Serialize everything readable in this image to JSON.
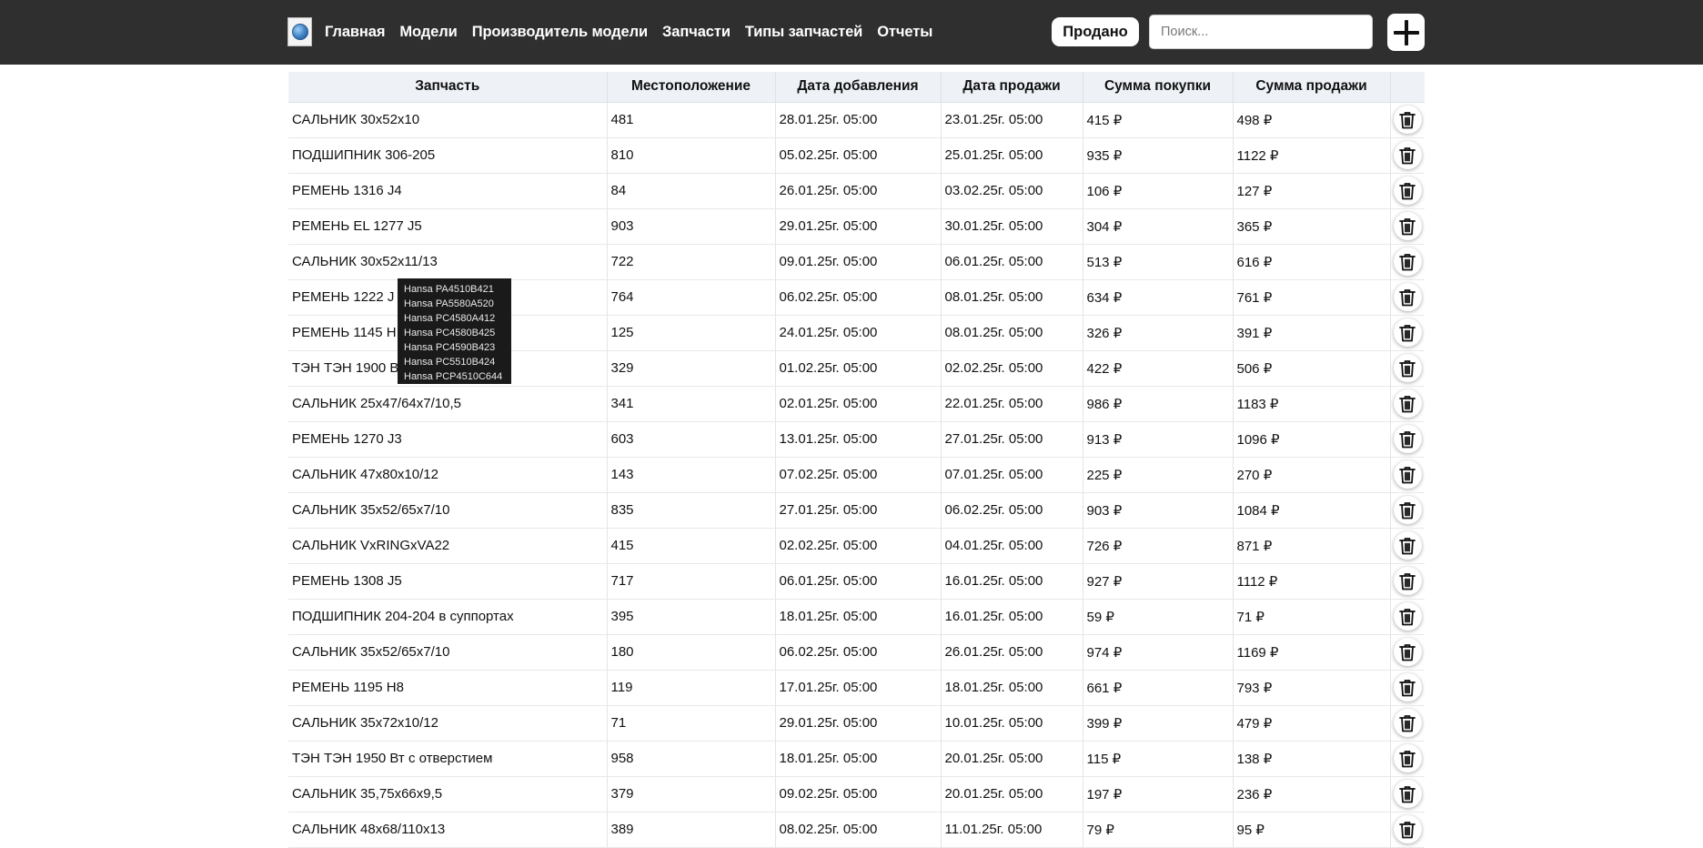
{
  "navbar": {
    "links": [
      "Главная",
      "Модели",
      "Производитель модели",
      "Запчасти",
      "Типы запчастей",
      "Отчеты"
    ],
    "sold_button": "Продано",
    "search_placeholder": "Поиск..."
  },
  "table": {
    "columns": [
      "Запчасть",
      "Местоположение",
      "Дата добавления",
      "Дата продажи",
      "Сумма покупки",
      "Сумма продажи",
      ""
    ],
    "rows": [
      [
        "САЛЬНИК 30x52x10",
        "481",
        "28.01.25г. 05:00",
        "23.01.25г. 05:00",
        "415 ₽",
        "498 ₽"
      ],
      [
        "ПОДШИПНИК 306-205",
        "810",
        "05.02.25г. 05:00",
        "25.01.25г. 05:00",
        "935 ₽",
        "1122 ₽"
      ],
      [
        "РЕМЕНЬ 1316 J4",
        "84",
        "26.01.25г. 05:00",
        "03.02.25г. 05:00",
        "106 ₽",
        "127 ₽"
      ],
      [
        "РЕМЕНЬ EL 1277 J5",
        "903",
        "29.01.25г. 05:00",
        "30.01.25г. 05:00",
        "304 ₽",
        "365 ₽"
      ],
      [
        "САЛЬНИК 30x52x11/13",
        "722",
        "09.01.25г. 05:00",
        "06.01.25г. 05:00",
        "513 ₽",
        "616 ₽"
      ],
      [
        "РЕМЕНЬ 1222 J",
        "764",
        "06.02.25г. 05:00",
        "08.01.25г. 05:00",
        "634 ₽",
        "761 ₽"
      ],
      [
        "РЕМЕНЬ 1145 H",
        "125",
        "24.01.25г. 05:00",
        "08.01.25г. 05:00",
        "326 ₽",
        "391 ₽"
      ],
      [
        "ТЭН ТЭН 1900 B",
        "329",
        "01.02.25г. 05:00",
        "02.02.25г. 05:00",
        "422 ₽",
        "506 ₽"
      ],
      [
        "САЛЬНИК 25x47/64x7/10,5",
        "341",
        "02.01.25г. 05:00",
        "22.01.25г. 05:00",
        "986 ₽",
        "1183 ₽"
      ],
      [
        "РЕМЕНЬ 1270 J3",
        "603",
        "13.01.25г. 05:00",
        "27.01.25г. 05:00",
        "913 ₽",
        "1096 ₽"
      ],
      [
        "САЛЬНИК 47x80x10/12",
        "143",
        "07.02.25г. 05:00",
        "07.01.25г. 05:00",
        "225 ₽",
        "270 ₽"
      ],
      [
        "САЛЬНИК 35x52/65x7/10",
        "835",
        "27.01.25г. 05:00",
        "06.02.25г. 05:00",
        "903 ₽",
        "1084 ₽"
      ],
      [
        "САЛЬНИК VxRINGxVA22",
        "415",
        "02.02.25г. 05:00",
        "04.01.25г. 05:00",
        "726 ₽",
        "871 ₽"
      ],
      [
        "РЕМЕНЬ 1308 J5",
        "717",
        "06.01.25г. 05:00",
        "16.01.25г. 05:00",
        "927 ₽",
        "1112 ₽"
      ],
      [
        "ПОДШИПНИК 204-204 в суппортах",
        "395",
        "18.01.25г. 05:00",
        "16.01.25г. 05:00",
        "59 ₽",
        "71 ₽"
      ],
      [
        "САЛЬНИК 35x52/65x7/10",
        "180",
        "06.02.25г. 05:00",
        "26.01.25г. 05:00",
        "974 ₽",
        "1169 ₽"
      ],
      [
        "РЕМЕНЬ 1195 H8",
        "119",
        "17.01.25г. 05:00",
        "18.01.25г. 05:00",
        "661 ₽",
        "793 ₽"
      ],
      [
        "САЛЬНИК 35x72x10/12",
        "71",
        "29.01.25г. 05:00",
        "10.01.25г. 05:00",
        "399 ₽",
        "479 ₽"
      ],
      [
        "ТЭН ТЭН 1950 Вт с отверстием",
        "958",
        "18.01.25г. 05:00",
        "20.01.25г. 05:00",
        "115 ₽",
        "138 ₽"
      ],
      [
        "САЛЬНИК 35,75x66x9,5",
        "379",
        "09.02.25г. 05:00",
        "20.01.25г. 05:00",
        "197 ₽",
        "236 ₽"
      ],
      [
        "САЛЬНИК 48x68/110x13",
        "389",
        "08.02.25г. 05:00",
        "11.01.25г. 05:00",
        "79 ₽",
        "95 ₽"
      ]
    ]
  },
  "tooltip": {
    "items": [
      "Hansa PA4510B421",
      "Hansa PA5580A520",
      "Hansa PC4580A412",
      "Hansa PC4580B425",
      "Hansa PC4590B423",
      "Hansa PC5510B424",
      "Hansa PCP4510C644"
    ]
  },
  "icons": {
    "logo": "globe-logo-icon",
    "add": "plus-icon",
    "delete": "trash-icon"
  }
}
